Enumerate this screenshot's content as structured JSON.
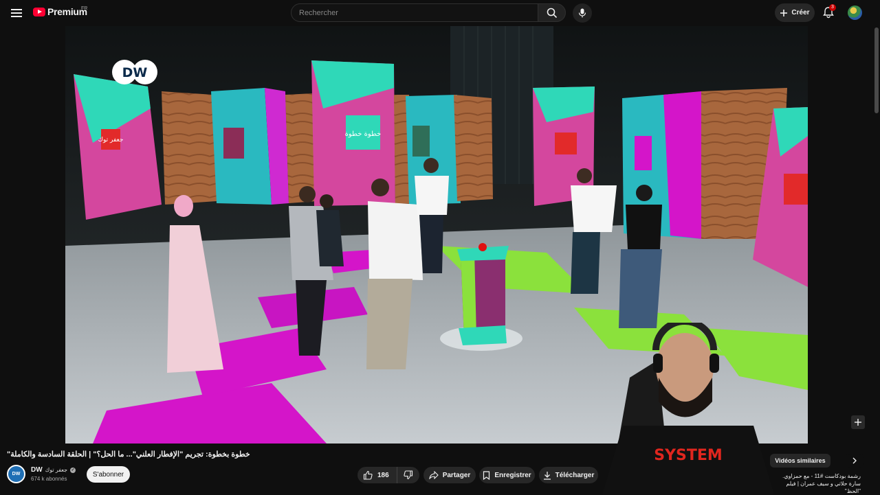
{
  "header": {
    "logo_text": "Premium",
    "region": "FR",
    "search_placeholder": "Rechercher",
    "create_label": "Créer",
    "notifications_count": "3"
  },
  "player": {
    "watermark": "DW",
    "set_signs": [
      "جعفر توك",
      "خطوة خطوة"
    ]
  },
  "video": {
    "title": "خطوة بخطوة: تجريم \"الإفطار العلني\"... ما الحل؟\" | الحلقة السادسة والكاملة\"",
    "channel_name": "DW",
    "channel_sub_name": "جعفر توك",
    "subscribers": "674 k abonnés",
    "subscribe_label": "S'abonner",
    "like_count": "186",
    "share_label": "Partager",
    "save_label": "Enregistrer",
    "download_label": "Télécharger"
  },
  "sidebar": {
    "chip_label": "Vidéos similaires",
    "rec_title_line1": "رشمة بودكاست #11 - مع حمزاوي.",
    "rec_title_line2": "سارة حلاتي و سيف عمران | فيلم \"الحظ\""
  },
  "webcam": {
    "shirt_text": "SYSTEM"
  },
  "colors": {
    "accent_red": "#ff0033",
    "background": "#0f0f0f",
    "pill_bg": "#272727"
  }
}
